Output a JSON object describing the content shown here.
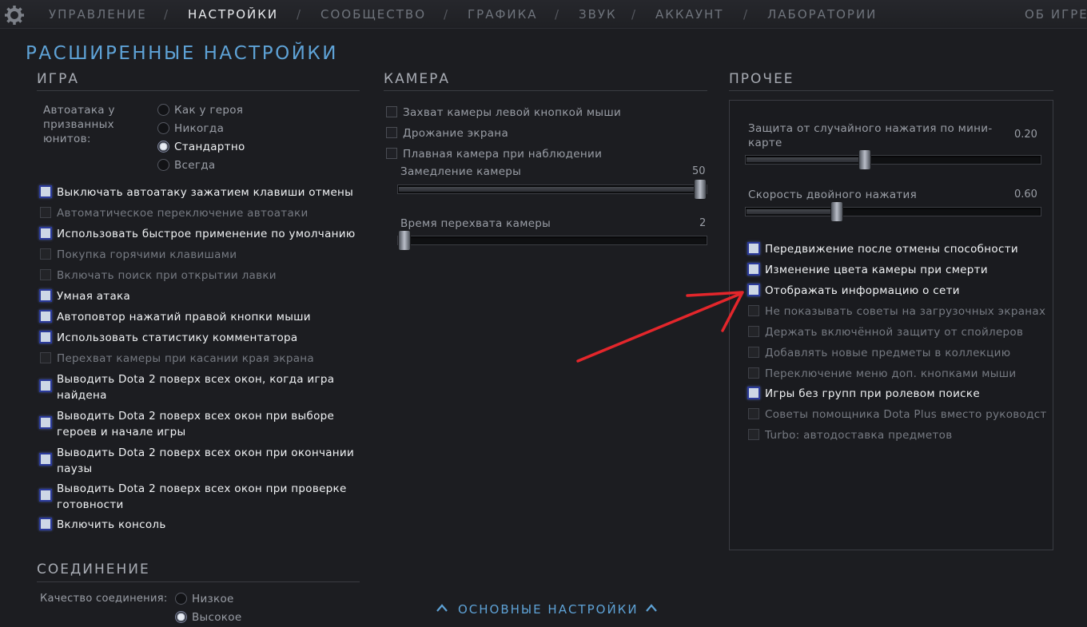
{
  "nav": {
    "items": [
      {
        "label": "УПРАВЛЕНИЕ"
      },
      {
        "label": "НАСТРОЙКИ"
      },
      {
        "label": "СООБЩЕСТВО"
      },
      {
        "label": "ГРАФИКА"
      },
      {
        "label": "ЗВУК"
      },
      {
        "label": "АККАУНТ"
      },
      {
        "label": "ЛАБОРАТОРИИ"
      },
      {
        "label": "ОБ ИГРЕ"
      }
    ],
    "separator": "/",
    "active": "НАСТРОЙКИ"
  },
  "page_title": "РАСШИРЕННЫЕ НАСТРОЙКИ",
  "game": {
    "title": "ИГРА",
    "autoattack": {
      "label_lines": [
        "Автоатака у",
        "призванных",
        "юнитов:"
      ],
      "options": [
        "Как у героя",
        "Никогда",
        "Стандартно",
        "Всегда"
      ],
      "selected": "Стандартно"
    },
    "options": [
      {
        "label": "Выключать автоатаку зажатием клавиши отмены",
        "checked": true,
        "enabled": true
      },
      {
        "label": "Автоматическое переключение автоатаки",
        "checked": false,
        "enabled": false
      },
      {
        "label": "Использовать быстрое применение по умолчанию",
        "checked": true,
        "enabled": true
      },
      {
        "label": "Покупка горячими клавишами",
        "checked": false,
        "enabled": false
      },
      {
        "label": "Включать поиск при открытии лавки",
        "checked": false,
        "enabled": false
      },
      {
        "label": "Умная атака",
        "checked": true,
        "enabled": true
      },
      {
        "label": "Автоповтор нажатий правой кнопки мыши",
        "checked": true,
        "enabled": true
      },
      {
        "label": "Использовать статистику комментатора",
        "checked": true,
        "enabled": true
      },
      {
        "label": "Перехват камеры при касании края экрана",
        "checked": false,
        "enabled": false
      },
      {
        "label": [
          "Выводить Dota 2 поверх всех окон, когда игра",
          "найдена"
        ],
        "checked": true,
        "enabled": true
      },
      {
        "label": [
          "Выводить Dota 2 поверх всех окон при выборе",
          "героев и начале игры"
        ],
        "checked": true,
        "enabled": true
      },
      {
        "label": [
          "Выводить Dota 2 поверх всех окон при окончании",
          "паузы"
        ],
        "checked": true,
        "enabled": true
      },
      {
        "label": [
          "Выводить Dota 2 поверх всех окон при проверке",
          "готовности"
        ],
        "checked": true,
        "enabled": true
      },
      {
        "label": "Включить консоль",
        "checked": true,
        "enabled": true
      }
    ]
  },
  "connection": {
    "title": "СОЕДИНЕНИЕ",
    "quality_label": "Качество соединения:",
    "options": [
      "Низкое",
      "Высокое"
    ],
    "selected": "Высокое"
  },
  "camera": {
    "title": "КАМЕРА",
    "options": [
      {
        "label": "Захват камеры левой кнопкой мыши",
        "checked": false
      },
      {
        "label": "Дрожание экрана",
        "checked": false
      },
      {
        "label": "Плавная камера при наблюдении",
        "checked": false
      }
    ],
    "sliders": [
      {
        "label": "Замедление камеры",
        "value": "50",
        "fraction": 1.0
      },
      {
        "label": "Время перехвата камеры",
        "value": "2",
        "fraction": 0.0
      }
    ]
  },
  "other": {
    "title": "ПРОЧЕЕ",
    "sliders": [
      {
        "label_lines": [
          "Защита от случайного нажатия по мини-",
          "карте"
        ],
        "value": "0.20",
        "fraction": 0.4
      },
      {
        "label_lines": [
          "Скорость двойного нажатия"
        ],
        "value": "0.60",
        "fraction": 0.3
      }
    ],
    "options": [
      {
        "label": "Передвижение после отмены способности",
        "checked": true,
        "enabled": true
      },
      {
        "label": "Изменение цвета камеры при смерти",
        "checked": true,
        "enabled": true
      },
      {
        "label": "Отображать информацию о сети",
        "checked": true,
        "enabled": true
      },
      {
        "label": "Не показывать советы на загрузочных экранах",
        "checked": false,
        "enabled": false
      },
      {
        "label": "Держать включённой защиту от спойлеров",
        "checked": false,
        "enabled": false
      },
      {
        "label": "Добавлять новые предметы в коллекцию",
        "checked": false,
        "enabled": false
      },
      {
        "label": "Переключение меню доп. кнопками мыши",
        "checked": false,
        "enabled": false
      },
      {
        "label": "Игры без групп при ролевом поиске",
        "checked": true,
        "enabled": true
      },
      {
        "label": "Советы помощника Dota Plus вместо руководст",
        "checked": false,
        "enabled": false
      },
      {
        "label": "Turbo: автодоставка предметов",
        "checked": false,
        "enabled": false
      }
    ]
  },
  "bottom_link": "ОСНОВНЫЕ НАСТРОЙКИ",
  "colors": {
    "accent": "#5ea2d6",
    "arrow": "#e3262b",
    "checkbox_border": "#2b3a9a"
  },
  "annotation_arrow": {
    "color": "#e3262b",
    "points_to": "Отображать информацию о сети"
  }
}
